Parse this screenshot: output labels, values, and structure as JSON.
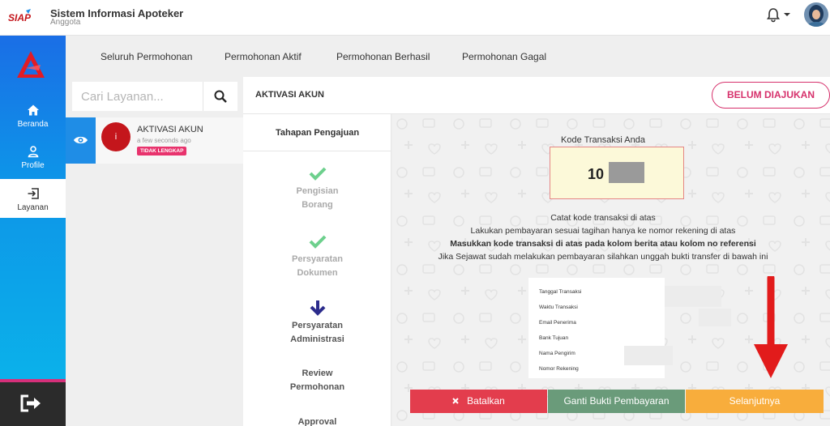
{
  "header": {
    "logo_text": "SIAP",
    "title": "Sistem Informasi Apoteker",
    "subtitle": "Anggota"
  },
  "sidebar": {
    "items": [
      {
        "label": "Beranda",
        "icon": "home-icon"
      },
      {
        "label": "Profile",
        "icon": "user-icon"
      },
      {
        "label": "Layanan",
        "icon": "login-icon",
        "active": true
      }
    ],
    "logout_icon": "logout-icon"
  },
  "tabs": [
    {
      "label": "Seluruh Permohonan"
    },
    {
      "label": "Permohonan Aktif"
    },
    {
      "label": "Permohonan Berhasil"
    },
    {
      "label": "Permohonan Gagal"
    }
  ],
  "search": {
    "placeholder": "Cari Layanan..."
  },
  "list": {
    "item": {
      "avatar_letter": "i",
      "title": "AKTIVASI AKUN",
      "time": "a few seconds ago",
      "badge": "TIDAK LENGKAP"
    }
  },
  "main": {
    "title": "AKTIVASI AKUN",
    "status": "BELUM DIAJUKAN"
  },
  "steps": {
    "title": "Tahapan Pengajuan",
    "items": [
      {
        "line1": "Pengisian",
        "line2": "Borang",
        "state": "done"
      },
      {
        "line1": "Persyaratan",
        "line2": "Dokumen",
        "state": "done"
      },
      {
        "line1": "Persyaratan",
        "line2": "Administrasi",
        "state": "current"
      },
      {
        "line1": "Review",
        "line2": "Permohonan",
        "state": "todo"
      },
      {
        "line1": "Approval",
        "line2": "",
        "state": "todo"
      }
    ]
  },
  "payment": {
    "code_label": "Kode Transaksi Anda",
    "code_visible": "10",
    "instructions": [
      "Catat kode transaksi di atas",
      "Lakukan pembayaran sesuai tagihan hanya ke nomor rekening di atas",
      "Masukkan kode transaksi di atas pada kolom berita atau kolom no referensi",
      "Jika Sejawat sudah melakukan pembayaran silahkan unggah bukti transfer di bawah ini"
    ],
    "details": [
      "Tanggal Transaksi",
      "Waktu Transaksi",
      "Email Penerima",
      "Bank Tujuan",
      "Nama Pengirim",
      "Nomor Rekening"
    ]
  },
  "actions": {
    "cancel": "Batalkan",
    "replace_proof": "Ganti Bukti Pembayaran",
    "next": "Selanjutnya"
  },
  "colors": {
    "brand_blue": "#1f8de6",
    "badge_pink": "#e8336d",
    "status_pink": "#d6306b",
    "cancel_red": "#e33d4d",
    "proof_green": "#6a9b7a",
    "next_orange": "#f8ad3c",
    "annotation_arrow": "#e21b1b"
  }
}
